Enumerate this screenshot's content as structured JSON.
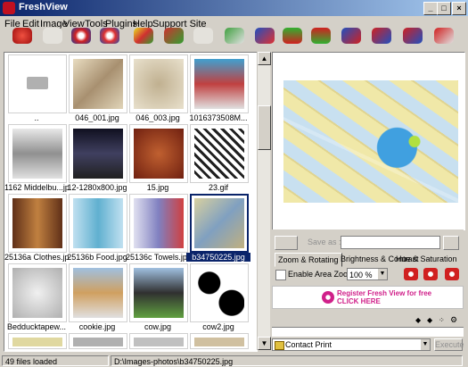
{
  "window": {
    "title": "FreshView"
  },
  "menu": [
    "File",
    "Edit",
    "Image",
    "View",
    "Tools",
    "Plugins",
    "Help",
    "Support Site"
  ],
  "thumbnails": [
    {
      "caption": ".."
    },
    {
      "caption": "046_001.jpg"
    },
    {
      "caption": "046_003.jpg"
    },
    {
      "caption": "1016373508M..."
    },
    {
      "caption": "1162 Middelbu...jpg"
    },
    {
      "caption": "12-1280x800.jpg"
    },
    {
      "caption": "15.jpg"
    },
    {
      "caption": "23.gif"
    },
    {
      "caption": "25136a  Clothes.jpg"
    },
    {
      "caption": "25136b  Food.jpg"
    },
    {
      "caption": "25136c  Towels.jpg"
    },
    {
      "caption": "b34750225.jpg"
    },
    {
      "caption": "Bedducktapew..."
    },
    {
      "caption": "cookie.jpg"
    },
    {
      "caption": "cow.jpg"
    },
    {
      "caption": "cow2.jpg"
    }
  ],
  "preview": {
    "save_as_label": "Save as :"
  },
  "tabs": [
    "Zoom & Rotating",
    "Brightness & Contrast",
    "Hue & Saturation"
  ],
  "zoom": {
    "enable_area_zoom_label": "Enable Area Zoom",
    "zoom_value": "100 %"
  },
  "banner": {
    "line1": "Register Fresh View for free",
    "line2": "CLICK HERE"
  },
  "plugin": {
    "selected": "Contact Print",
    "execute_label": "Execute"
  },
  "status": {
    "files_loaded": "49 files loaded",
    "path": "D:\\Images-photos\\b34750225.jpg"
  }
}
